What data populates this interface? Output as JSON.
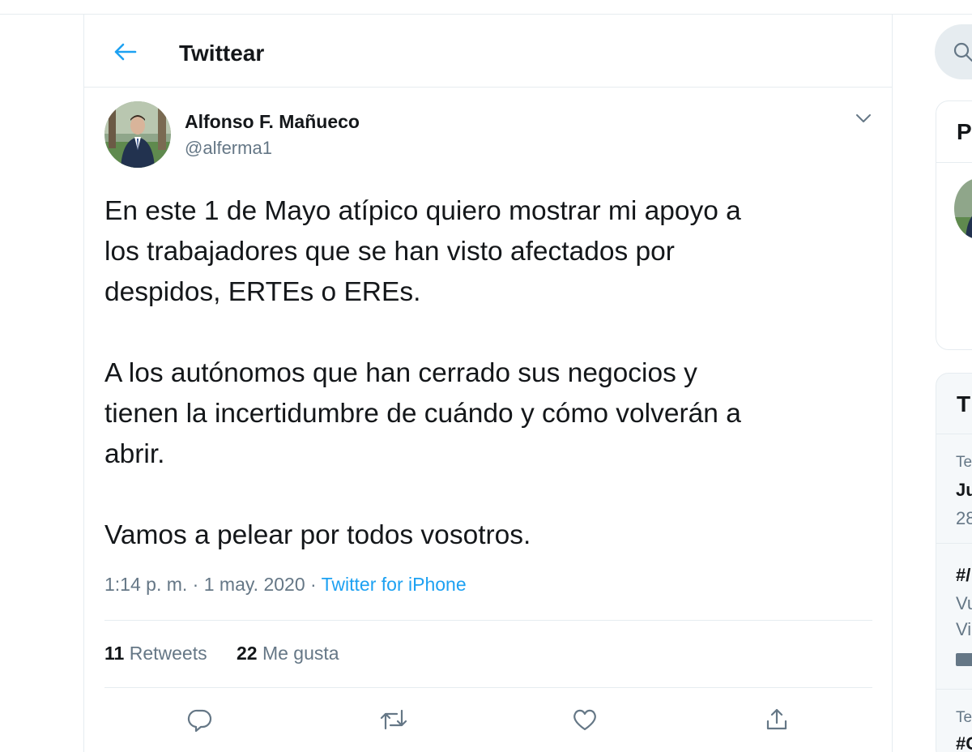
{
  "header": {
    "title": "Twittear",
    "back_icon": "arrow-left-icon"
  },
  "tweet": {
    "author_name": "Alfonso F. Mañueco",
    "author_handle": "@alferma1",
    "lines": [
      "En este 1 de Mayo atípico quiero mostrar mi apoyo a",
      "los trabajadores que se han visto afectados por",
      "despidos, ERTEs o EREs.",
      "",
      "A los autónomos que han cerrado sus negocios y",
      "tienen la incertidumbre de cuándo y cómo volverán a",
      "abrir.",
      "",
      "Vamos a pelear por todos vosotros."
    ],
    "time": "1:14 p. m.",
    "date": "1 may. 2020",
    "separator": "·",
    "source": "Twitter for iPhone",
    "retweets_count": "11",
    "retweets_label": "Retweets",
    "likes_count": "22",
    "likes_label": "Me gusta"
  },
  "actions": {
    "reply_icon": "reply-icon",
    "retweet_icon": "retweet-icon",
    "like_icon": "heart-icon",
    "share_icon": "share-icon"
  },
  "sidebar": {
    "card1_title_fragment": "P",
    "card2_title_fragment": "T",
    "trend_1_category": "Te",
    "trend_1_name": "Ju",
    "trend_1_count": "28",
    "trend_2_name": "#/",
    "trend_2_line1": "Vu",
    "trend_2_line2": "Vi",
    "trend_3_category": "Te",
    "trend_3_name": "#C"
  },
  "colors": {
    "accent": "#1da1f2",
    "text": "#14171a",
    "secondary": "#657786",
    "border": "#e6ecf0"
  }
}
